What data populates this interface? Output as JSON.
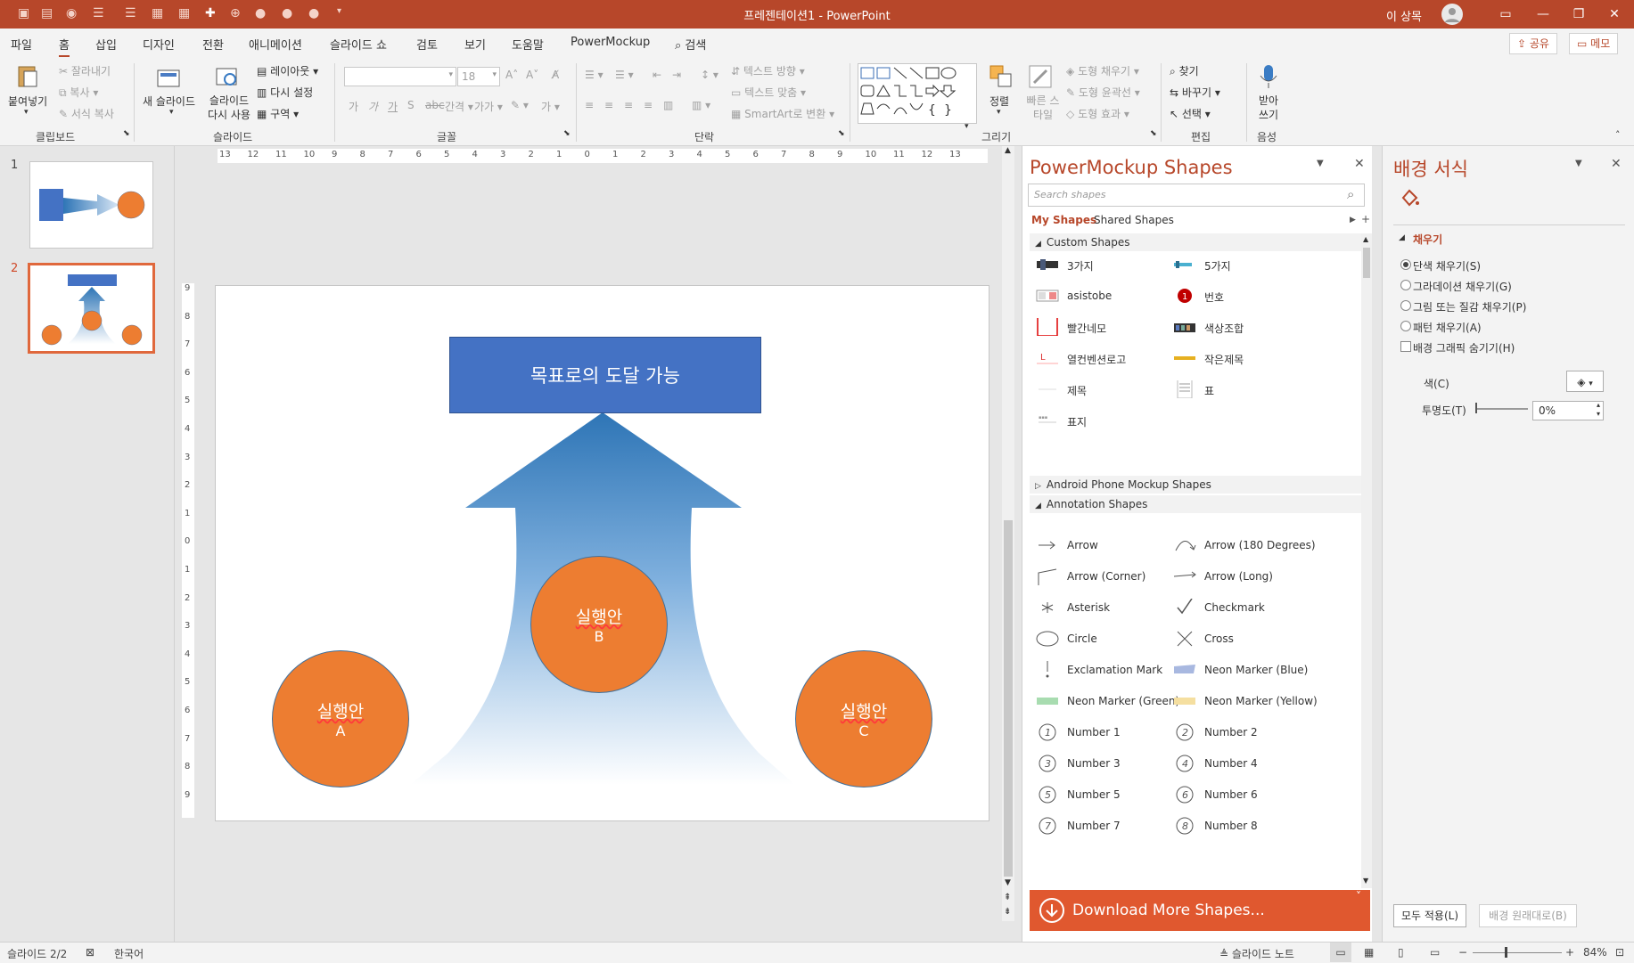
{
  "window": {
    "title": "프레젠테이션1  -  PowerPoint",
    "user": "이 상목",
    "controls": {
      "ribbon_display": "▭",
      "minimize": "—",
      "restore": "❐",
      "close": "✕"
    }
  },
  "menu": {
    "tabs": [
      "파일",
      "홈",
      "삽입",
      "디자인",
      "전환",
      "애니메이션",
      "슬라이드 쇼",
      "검토",
      "보기",
      "도움말",
      "PowerMockup"
    ],
    "active_tab": "홈",
    "search": "검색",
    "share": "공유",
    "comments": "메모"
  },
  "ribbon": {
    "clipboard": {
      "label": "클립보드",
      "paste": "붙여넣기",
      "cut": "잘라내기",
      "copy": "복사",
      "format_painter": "서식 복사"
    },
    "slides": {
      "label": "슬라이드",
      "new_slide": "새 슬라이드",
      "reuse": "슬라이드 다시 사용",
      "layout": "레이아웃",
      "reset": "다시 설정",
      "section": "구역"
    },
    "font": {
      "label": "글꼴",
      "size": "18"
    },
    "paragraph": {
      "label": "단락",
      "text_direction": "텍스트 방향",
      "align_text": "텍스트 맞춤",
      "smartart": "SmartArt로 변환"
    },
    "drawing": {
      "label": "그리기",
      "arrange": "정렬",
      "quick_styles": "빠른 스타일",
      "shape_fill": "도형 채우기",
      "shape_outline": "도형 윤곽선",
      "shape_effects": "도형 효과"
    },
    "editing": {
      "label": "편집",
      "find": "찾기",
      "replace": "바꾸기",
      "select": "선택"
    },
    "voice": {
      "label": "음성",
      "dictate": "받아쓰기"
    }
  },
  "slides_panel": {
    "numbers": [
      "1",
      "2"
    ],
    "selected": 2
  },
  "slide": {
    "goal_box": "목표로의 도달 가능",
    "circles": [
      {
        "line1": "실행안",
        "line2": "A"
      },
      {
        "line1": "실행안",
        "line2": "B"
      },
      {
        "line1": "실행안",
        "line2": "C"
      }
    ]
  },
  "ruler": {
    "horizontal": [
      "13",
      "12",
      "11",
      "10",
      "9",
      "8",
      "7",
      "6",
      "5",
      "4",
      "3",
      "2",
      "1",
      "0",
      "1",
      "2",
      "3",
      "4",
      "5",
      "6",
      "7",
      "8",
      "9",
      "10",
      "11",
      "12",
      "13"
    ],
    "vertical": [
      "9",
      "8",
      "7",
      "6",
      "5",
      "4",
      "3",
      "2",
      "1",
      "0",
      "1",
      "2",
      "3",
      "4",
      "5",
      "6",
      "7",
      "8",
      "9"
    ]
  },
  "powermockup": {
    "title": "PowerMockup Shapes",
    "search_placeholder": "Search shapes",
    "tabs": [
      "My Shapes",
      "Shared Shapes"
    ],
    "sections": [
      "Custom Shapes",
      "Android Phone Mockup Shapes",
      "Annotation Shapes"
    ],
    "custom_shapes": [
      "3가지",
      "5가지",
      "asistobe",
      "번호",
      "빨간네모",
      "색상조합",
      "열컨벤션로고",
      "작은제목",
      "제목",
      "표",
      "표지"
    ],
    "annotation_shapes": [
      "Arrow",
      "Arrow (180 Degrees)",
      "Arrow (Corner)",
      "Arrow (Long)",
      "Asterisk",
      "Checkmark",
      "Circle",
      "Cross",
      "Exclamation Mark",
      "Neon Marker (Blue)",
      "Neon Marker (Green)",
      "Neon Marker (Yellow)",
      "Number 1",
      "Number 2",
      "Number 3",
      "Number 4",
      "Number 5",
      "Number 6",
      "Number 7",
      "Number 8"
    ],
    "number_badge": "1",
    "download": "Download More Shapes..."
  },
  "format_pane": {
    "title": "배경 서식",
    "section": "채우기",
    "options": [
      "단색 채우기(S)",
      "그라데이션 채우기(G)",
      "그림 또는 질감 채우기(P)",
      "패턴 채우기(A)"
    ],
    "selected_option": "단색 채우기(S)",
    "hide_graphics": "배경 그래픽 숨기기(H)",
    "color_label": "색(C)",
    "transparency_label": "투명도(T)",
    "transparency_value": "0%",
    "apply_all": "모두 적용(L)",
    "reset_bg": "배경 원래대로(B)"
  },
  "status": {
    "slide": "슬라이드 2/2",
    "language": "한국어",
    "notes": "슬라이드 노트",
    "zoom": "84%"
  },
  "colors": {
    "accent": "#b7472a",
    "goal_box": "#4472c4",
    "circle": "#ed7d31",
    "arrow_top": "#2e75b6"
  }
}
